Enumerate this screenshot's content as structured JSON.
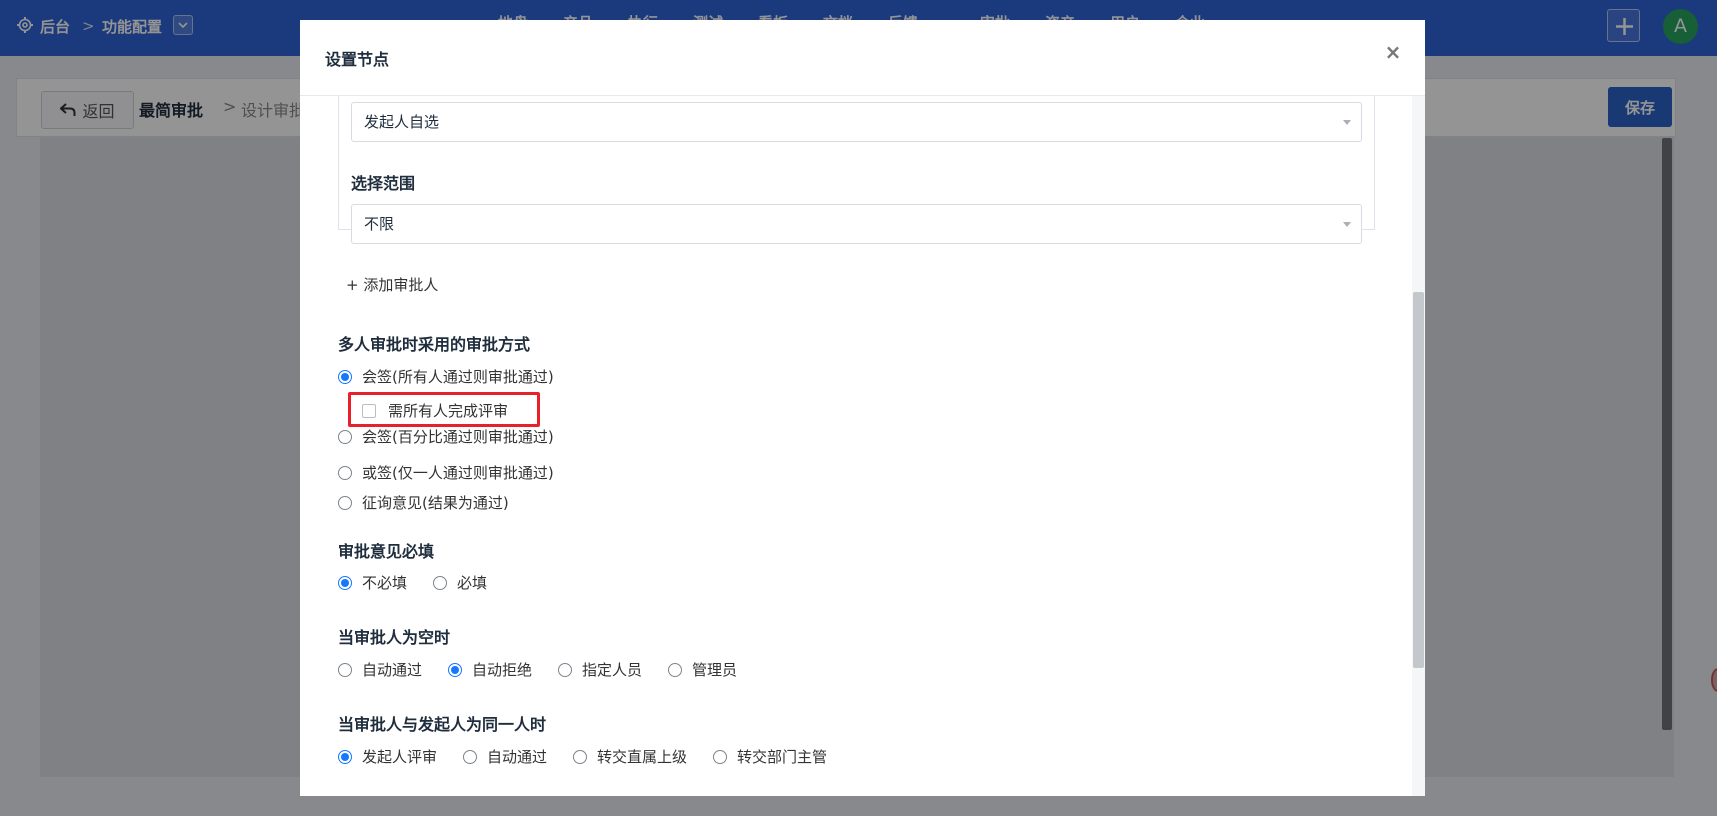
{
  "topbar": {
    "home_label": "后台",
    "separator": ">",
    "config_label": "功能配置",
    "nav_items": [
      "地盘",
      "产品",
      "执行",
      "测试",
      "看板",
      "文档",
      "反馈",
      "审批",
      "资产",
      "用户",
      "企业"
    ],
    "avatar_letter": "A"
  },
  "subheader": {
    "back_label": "返回",
    "flow_name": "最简审批",
    "separator": ">",
    "page_label": "设计审批",
    "save_label": "保存"
  },
  "modal": {
    "title": "设置节点",
    "close_glyph": "×",
    "approver_type_value": "发起人自选",
    "scope_label": "选择范围",
    "scope_value": "不限",
    "add_approver_label": "+ 添加审批人",
    "multi_section": {
      "title": "多人审批时采用的审批方式",
      "options": [
        {
          "label": "会签(所有人通过则审批通过)",
          "checked": true
        },
        {
          "label": "会签(百分比通过则审批通过)",
          "checked": false
        },
        {
          "label": "或签(仅一人通过则审批通过)",
          "checked": false
        },
        {
          "label": "征询意见(结果为通过)",
          "checked": false
        }
      ],
      "sub_checkbox_label": "需所有人完成评审",
      "sub_checkbox_checked": false
    },
    "comment_section": {
      "title": "审批意见必填",
      "options": [
        {
          "label": "不必填",
          "checked": true
        },
        {
          "label": "必填",
          "checked": false
        }
      ]
    },
    "empty_section": {
      "title": "当审批人为空时",
      "options": [
        {
          "label": "自动通过",
          "checked": false
        },
        {
          "label": "自动拒绝",
          "checked": true
        },
        {
          "label": "指定人员",
          "checked": false
        },
        {
          "label": "管理员",
          "checked": false
        }
      ]
    },
    "same_section": {
      "title": "当审批人与发起人为同一人时",
      "options": [
        {
          "label": "发起人评审",
          "checked": true
        },
        {
          "label": "自动通过",
          "checked": false
        },
        {
          "label": "转交直属上级",
          "checked": false
        },
        {
          "label": "转交部门主管",
          "checked": false
        }
      ]
    }
  }
}
